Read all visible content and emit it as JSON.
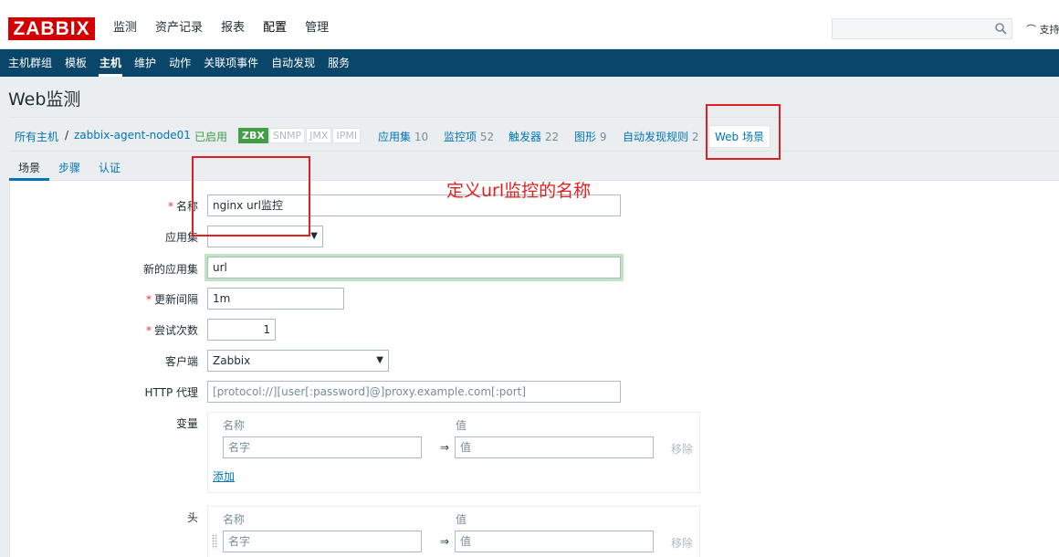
{
  "app": {
    "logo": "ZABBIX"
  },
  "main_nav": [
    "监测",
    "资产记录",
    "报表",
    "配置",
    "管理"
  ],
  "support_label": "支持",
  "sub_nav": [
    "主机群组",
    "模板",
    "主机",
    "维护",
    "动作",
    "关联项事件",
    "自动发现",
    "服务"
  ],
  "page_title": "Web监测",
  "breadcrumb": {
    "all_hosts": "所有主机",
    "separator": "/",
    "host": "zabbix-agent-node01",
    "status": "已启用",
    "badges": [
      "ZBX",
      "SNMP",
      "JMX",
      "IPMI"
    ],
    "links": [
      {
        "label": "应用集",
        "count": "10"
      },
      {
        "label": "监控项",
        "count": "52"
      },
      {
        "label": "触发器",
        "count": "22"
      },
      {
        "label": "图形",
        "count": "9"
      },
      {
        "label": "自动发现规则",
        "count": "2"
      }
    ],
    "web": "Web 场景"
  },
  "tabs": [
    "场景",
    "步骤",
    "认证"
  ],
  "form": {
    "name_label": "名称",
    "name_value": "nginx url监控",
    "app_label": "应用集",
    "app_value": "",
    "new_app_label": "新的应用集",
    "new_app_value": "url",
    "interval_label": "更新间隔",
    "interval_value": "1m",
    "attempts_label": "尝试次数",
    "attempts_value": "1",
    "agent_label": "客户端",
    "agent_value": "Zabbix",
    "proxy_label": "HTTP 代理",
    "proxy_placeholder": "[protocol://][user[:password]@]proxy.example.com[:port]",
    "variables_label": "变量",
    "headers_label": "头",
    "col_name": "名称",
    "col_value": "值",
    "name_placeholder": "名字",
    "value_placeholder": "值",
    "remove_label": "移除",
    "add_label": "添加",
    "arrow": "⇒"
  },
  "annotation": "定义url监控的名称",
  "colors": {
    "logo": "#d40000",
    "subnav": "#0a466a",
    "link": "#0275b8",
    "enabled": "#429e47",
    "annotation": "#e02020"
  }
}
